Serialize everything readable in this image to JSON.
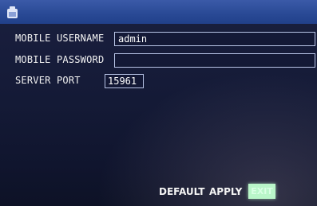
{
  "header": {
    "icon": "back-icon"
  },
  "fields": {
    "mobile_username": {
      "label": "MOBILE USERNAME",
      "value": "admin"
    },
    "mobile_password": {
      "label": "MOBILE PASSWORD",
      "value": ""
    },
    "server_port": {
      "label": "SERVER PORT",
      "value": "15961"
    }
  },
  "footer": {
    "default_label": "DEFAULT",
    "apply_label": "APPLY",
    "exit_label": "EXIT"
  },
  "colors": {
    "background": "#141a36",
    "header": "#2a4a96",
    "field_border": "#b8c4e6",
    "highlight": "#b9f6c9"
  }
}
